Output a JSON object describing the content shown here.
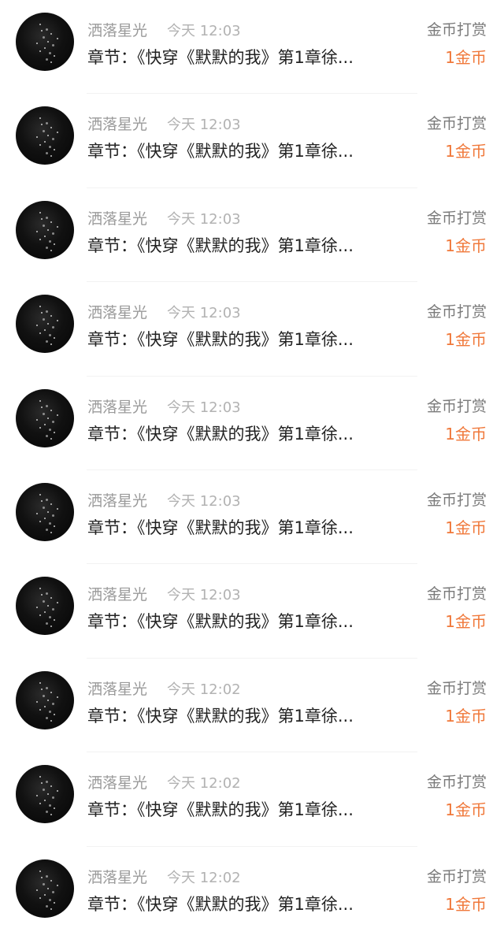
{
  "colors": {
    "accent_orange": "#f0783a",
    "name_gray": "#9a9a9a",
    "time_gray": "#b2b2b2",
    "text_dark": "#222222"
  },
  "records": [
    {
      "user": "洒落星光",
      "time": "今天 12:03",
      "type": "金币打赏",
      "chapter": "章节：《快穿《默默的我》第1章徐...",
      "amount": "1金币",
      "avatar_icon": "starry-avatar-icon"
    },
    {
      "user": "洒落星光",
      "time": "今天 12:03",
      "type": "金币打赏",
      "chapter": "章节：《快穿《默默的我》第1章徐...",
      "amount": "1金币",
      "avatar_icon": "starry-avatar-icon"
    },
    {
      "user": "洒落星光",
      "time": "今天 12:03",
      "type": "金币打赏",
      "chapter": "章节：《快穿《默默的我》第1章徐...",
      "amount": "1金币",
      "avatar_icon": "starry-avatar-icon"
    },
    {
      "user": "洒落星光",
      "time": "今天 12:03",
      "type": "金币打赏",
      "chapter": "章节：《快穿《默默的我》第1章徐...",
      "amount": "1金币",
      "avatar_icon": "starry-avatar-icon"
    },
    {
      "user": "洒落星光",
      "time": "今天 12:03",
      "type": "金币打赏",
      "chapter": "章节：《快穿《默默的我》第1章徐...",
      "amount": "1金币",
      "avatar_icon": "starry-avatar-icon"
    },
    {
      "user": "洒落星光",
      "time": "今天 12:03",
      "type": "金币打赏",
      "chapter": "章节：《快穿《默默的我》第1章徐...",
      "amount": "1金币",
      "avatar_icon": "starry-avatar-icon"
    },
    {
      "user": "洒落星光",
      "time": "今天 12:03",
      "type": "金币打赏",
      "chapter": "章节：《快穿《默默的我》第1章徐...",
      "amount": "1金币",
      "avatar_icon": "starry-avatar-icon"
    },
    {
      "user": "洒落星光",
      "time": "今天 12:02",
      "type": "金币打赏",
      "chapter": "章节：《快穿《默默的我》第1章徐...",
      "amount": "1金币",
      "avatar_icon": "starry-avatar-icon"
    },
    {
      "user": "洒落星光",
      "time": "今天 12:02",
      "type": "金币打赏",
      "chapter": "章节：《快穿《默默的我》第1章徐...",
      "amount": "1金币",
      "avatar_icon": "starry-avatar-icon"
    },
    {
      "user": "洒落星光",
      "time": "今天 12:02",
      "type": "金币打赏",
      "chapter": "章节：《快穿《默默的我》第1章徐...",
      "amount": "1金币",
      "avatar_icon": "starry-avatar-icon"
    }
  ]
}
